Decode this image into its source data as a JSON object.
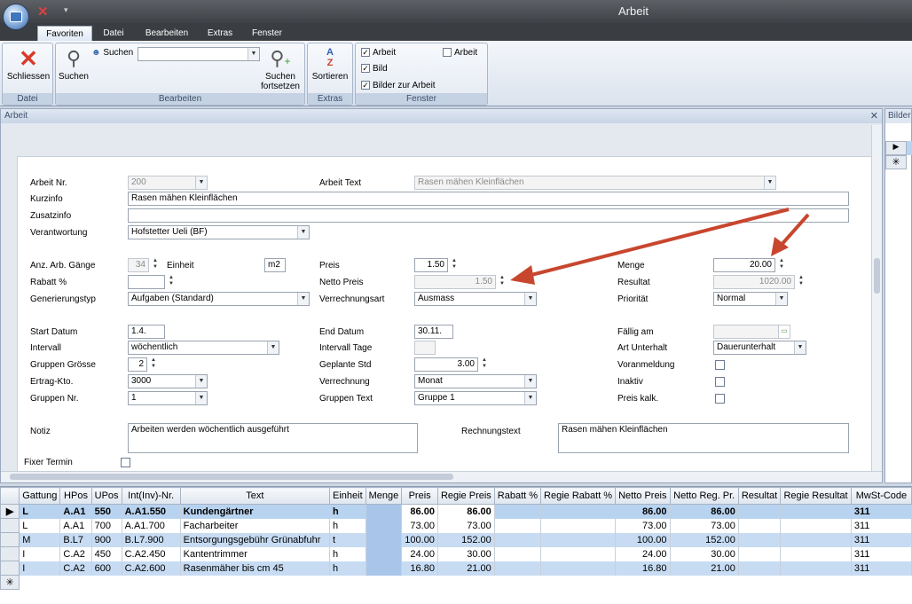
{
  "window": {
    "title": "Arbeit"
  },
  "tabs": [
    "Favoriten",
    "Datei",
    "Bearbeiten",
    "Extras",
    "Fenster"
  ],
  "ribbon": {
    "groups": {
      "datei": "Datei",
      "bearbeiten": "Bearbeiten",
      "extras": "Extras",
      "fenster": "Fenster"
    },
    "schliessen": "Schliessen",
    "suchen": "Suchen",
    "suchen_small": "Suchen",
    "suchen_fortsetzen_1": "Suchen",
    "suchen_fortsetzen_2": "fortsetzen",
    "sortieren": "Sortieren",
    "fenster_items": {
      "arbeit": "Arbeit",
      "bild": "Bild",
      "bilder_zur_arbeit": "Bilder zur Arbeit",
      "arbeit2": "Arbeit"
    }
  },
  "panel": {
    "title": "Arbeit",
    "right_title": "Bilder"
  },
  "form": {
    "arbeit_nr": {
      "label": "Arbeit Nr.",
      "value": "200"
    },
    "arbeit_text": {
      "label": "Arbeit Text",
      "value": "Rasen mähen Kleinflächen"
    },
    "kurzinfo": {
      "label": "Kurzinfo",
      "value": "Rasen mähen Kleinflächen"
    },
    "zusatzinfo": {
      "label": "Zusatzinfo",
      "value": ""
    },
    "verantwortung": {
      "label": "Verantwortung",
      "value": "Hofstetter Ueli (BF)"
    },
    "anz_arb_gaenge": {
      "label": "Anz. Arb. Gänge",
      "value": "34"
    },
    "einheit": {
      "label": "Einheit",
      "value": "m2"
    },
    "preis": {
      "label": "Preis",
      "value": "1.50"
    },
    "menge": {
      "label": "Menge",
      "value": "20.00"
    },
    "rabatt": {
      "label": "Rabatt %",
      "value": ""
    },
    "netto_preis": {
      "label": "Netto Preis",
      "value": "1.50"
    },
    "resultat": {
      "label": "Resultat",
      "value": "1020.00"
    },
    "generierungstyp": {
      "label": "Generierungstyp",
      "value": "Aufgaben (Standard)"
    },
    "verrechnungsart": {
      "label": "Verrechnungsart",
      "value": "Ausmass"
    },
    "prioritaet": {
      "label": "Priorität",
      "value": "Normal"
    },
    "start_datum": {
      "label": "Start Datum",
      "value": "1.4."
    },
    "end_datum": {
      "label": "End Datum",
      "value": "30.11."
    },
    "faellig_am": {
      "label": "Fällig am",
      "value": ""
    },
    "intervall": {
      "label": "Intervall",
      "value": "wöchentlich"
    },
    "intervall_tage": {
      "label": "Intervall Tage",
      "value": ""
    },
    "art_unterhalt": {
      "label": "Art Unterhalt",
      "value": "Dauerunterhalt"
    },
    "gruppen_groesse": {
      "label": "Gruppen Grösse",
      "value": "2"
    },
    "geplante_std": {
      "label": "Geplante Std",
      "value": "3.00"
    },
    "voranmeldung": {
      "label": "Voranmeldung"
    },
    "ertrag_kto": {
      "label": "Ertrag-Kto.",
      "value": "3000"
    },
    "verrechnung": {
      "label": "Verrechnung",
      "value": "Monat"
    },
    "inaktiv": {
      "label": "Inaktiv"
    },
    "gruppen_nr": {
      "label": "Gruppen Nr.",
      "value": "1"
    },
    "gruppen_text": {
      "label": "Gruppen Text",
      "value": "Gruppe 1"
    },
    "preis_kalk": {
      "label": "Preis kalk."
    },
    "notiz": {
      "label": "Notiz",
      "value": "Arbeiten werden wöchentlich ausgeführt"
    },
    "rechnungstext": {
      "label": "Rechnungstext",
      "value": "Rasen mähen Kleinflächen"
    },
    "fixer_termin": {
      "label": "Fixer Termin"
    }
  },
  "grid": {
    "columns": [
      "Gattung",
      "HPos",
      "UPos",
      "Int(Inv)-Nr.",
      "Text",
      "Einheit",
      "Menge",
      "Preis",
      "Regie Preis",
      "Rabatt %",
      "Regie Rabatt %",
      "Netto Preis",
      "Netto Reg. Pr.",
      "Resultat",
      "Regie Resultat",
      "MwSt-Code"
    ],
    "rows": [
      [
        "L",
        "A.A1",
        "550",
        "A.A1.550",
        "Kundengärtner",
        "h",
        "",
        "86.00",
        "86.00",
        "",
        "",
        "86.00",
        "86.00",
        "",
        "",
        "311"
      ],
      [
        "L",
        "A.A1",
        "700",
        "A.A1.700",
        "Facharbeiter",
        "h",
        "",
        "73.00",
        "73.00",
        "",
        "",
        "73.00",
        "73.00",
        "",
        "",
        "311"
      ],
      [
        "M",
        "B.L7",
        "900",
        "B.L7.900",
        "Entsorgungsgebühr Grünabfuhr",
        "t",
        "",
        "100.00",
        "152.00",
        "",
        "",
        "100.00",
        "152.00",
        "",
        "",
        "311"
      ],
      [
        "I",
        "C.A2",
        "450",
        "C.A2.450",
        "Kantentrimmer",
        "h",
        "",
        "24.00",
        "30.00",
        "",
        "",
        "24.00",
        "30.00",
        "",
        "",
        "311"
      ],
      [
        "I",
        "C.A2",
        "600",
        "C.A2.600",
        "Rasenmäher bis  cm  45",
        "h",
        "",
        "16.80",
        "21.00",
        "",
        "",
        "16.80",
        "21.00",
        "",
        "",
        "311"
      ]
    ]
  },
  "colors": {
    "arrow": "#c8462e",
    "selection": "#b8d3f0"
  }
}
